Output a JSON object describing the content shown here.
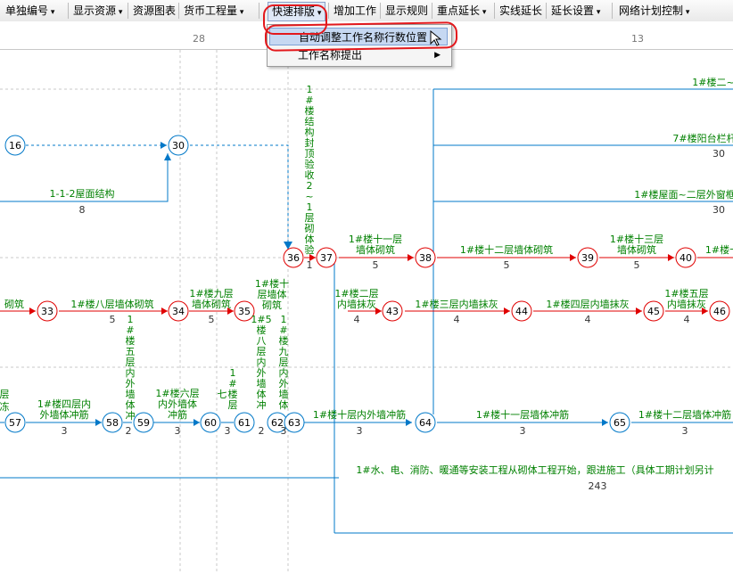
{
  "toolbar": {
    "items": [
      "单独编号",
      "显示资源",
      "资源图表",
      "货币工程量",
      "快速排版",
      "增加工作",
      "显示规则",
      "重点延长",
      "实线延长",
      "延长设置",
      "网络计划控制"
    ]
  },
  "ruler": {
    "labels": [
      "28",
      "13"
    ]
  },
  "menu": {
    "items": [
      "自动调整工作名称行数位置",
      "工作名称提出"
    ]
  },
  "colors": {
    "critical": "#e00000",
    "normal": "#0078c8",
    "label": "#008000",
    "float": "#0078c8"
  },
  "network": {
    "nodes": [
      "16",
      "30",
      "36",
      "37",
      "38",
      "39",
      "40",
      "33",
      "34",
      "35",
      "43",
      "44",
      "45",
      "46",
      "57",
      "58",
      "59",
      "60",
      "61",
      "62",
      "63",
      "64",
      "65"
    ],
    "tasks": [
      {
        "name": "1-1-2屋面结构",
        "dur": "8"
      },
      {
        "name": "1#楼结构封顶验收",
        "dur": "1"
      },
      {
        "name": "2~10层砌体验收",
        "dur": "1"
      },
      {
        "name": "1#楼十一层墙体砌筑",
        "dur": "5"
      },
      {
        "name": "1#楼十二层墙体砌筑",
        "dur": "5"
      },
      {
        "name": "1#楼十三层墙体砌筑",
        "dur": "5"
      },
      {
        "name": "1#楼八层墙体砌筑",
        "dur": "5"
      },
      {
        "name": "1#楼九层墙体砌筑",
        "dur": "5"
      },
      {
        "name": "1#楼十层墙体砌筑",
        "dur": ""
      },
      {
        "name": "1#楼二层内墙抹灰",
        "dur": "4"
      },
      {
        "name": "1#楼三层内墙抹灰",
        "dur": "4"
      },
      {
        "name": "1#楼四层内墙抹灰",
        "dur": "4"
      },
      {
        "name": "1#楼五层内墙抹灰",
        "dur": "4"
      },
      {
        "name": "1#楼四层内外墙冲筋",
        "dur": "3"
      },
      {
        "name": "1#楼五层内外墙冲筋",
        "dur": "2"
      },
      {
        "name": "1#楼六层内外墙冲筋",
        "dur": "3"
      },
      {
        "name": "1#楼七层内外墙冲筋",
        "dur": "3"
      },
      {
        "name": "1#楼八层内外墙冲筋",
        "dur": "2"
      },
      {
        "name": "1#楼九层内外墙冲筋",
        "dur": "3"
      },
      {
        "name": "1#楼十层内外墙冲筋",
        "dur": "3"
      },
      {
        "name": "1#楼十一层墙体冲筋",
        "dur": "3"
      },
      {
        "name": "1#楼十二层墙体冲筋",
        "dur": "3"
      },
      {
        "name": "1#水、电、消防、暖通等安装工程从砌体工程开始，跟进施工（具体工期计划另计",
        "dur": "243"
      },
      {
        "name": "1#楼二~",
        "dur": ""
      },
      {
        "name": "7#楼阳台栏杆",
        "dur": "30"
      },
      {
        "name": "1#楼屋面~二层外窗框",
        "dur": "30"
      }
    ]
  },
  "fragments": {
    "left1": "砌筑",
    "left2a": "层",
    "left2b": "冻",
    "t1b_1": "1#楼十"
  }
}
